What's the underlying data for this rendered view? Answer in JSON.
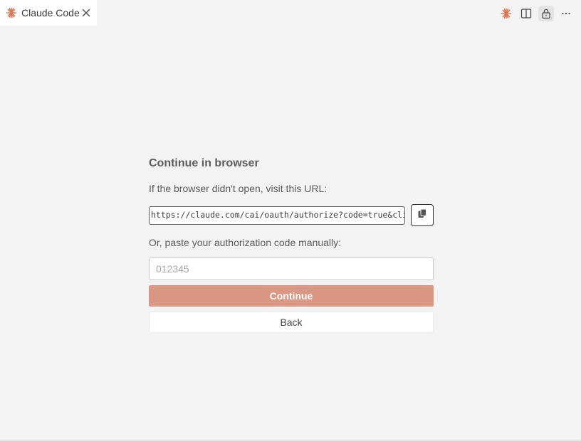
{
  "tab": {
    "title": "Claude Code",
    "icon": "claude-spark-icon",
    "close_icon": "close-icon"
  },
  "actions": [
    {
      "name": "claude-spark-icon"
    },
    {
      "name": "split-editor-icon"
    },
    {
      "name": "lock-icon",
      "active": true
    },
    {
      "name": "more-icon"
    }
  ],
  "colors": {
    "accent": "#d97757",
    "continue_button": "#da9884",
    "background": "#f3f3f3"
  },
  "panel": {
    "heading": "Continue in browser",
    "url_prompt": "If the browser didn't open, visit this URL:",
    "url": "https://claude.com/cai/oauth/authorize?code=true&client_id",
    "copy_icon": "copy-icon",
    "manual_prompt": "Or, paste your authorization code manually:",
    "code_placeholder": "012345",
    "code_value": "",
    "continue_label": "Continue",
    "back_label": "Back"
  }
}
